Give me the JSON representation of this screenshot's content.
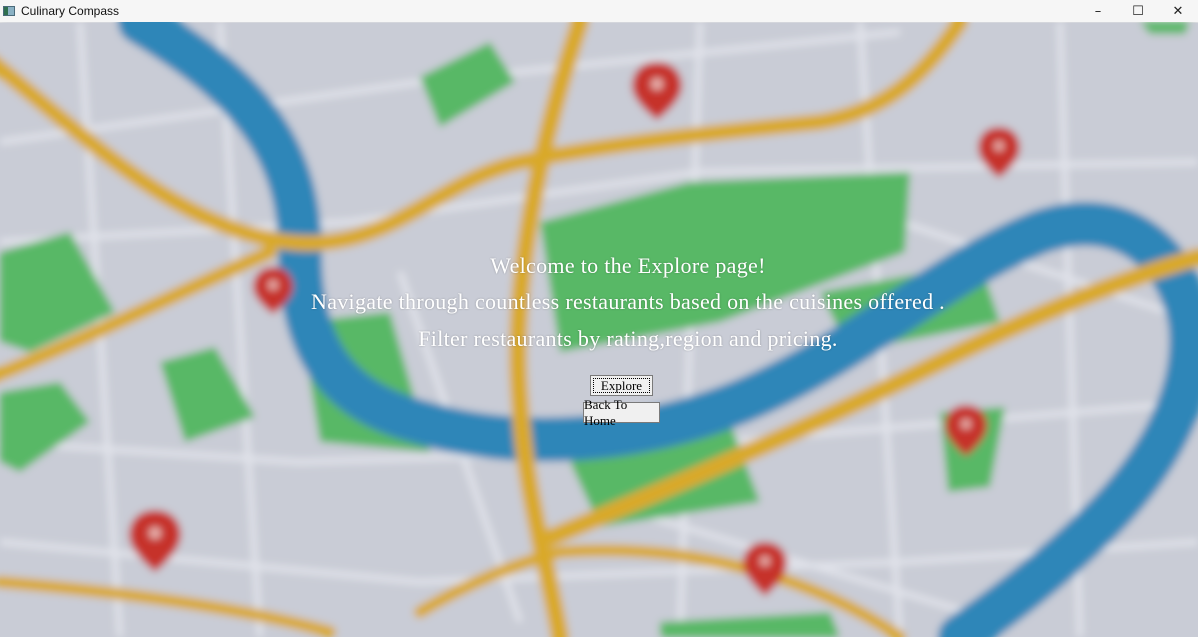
{
  "window": {
    "title": "Culinary Compass",
    "controls": {
      "minimize": "–",
      "maximize": "☐",
      "close": "✕"
    }
  },
  "main": {
    "welcome_line": "Welcome to the Explore page!",
    "navigate_line": "Navigate through countless restaurants based on the cuisines offered .",
    "filter_line": "Filter restaurants by rating,region and pricing.",
    "explore_button": "Explore",
    "back_button": "Back To Home"
  },
  "colors": {
    "map_base": "#c9ccd6",
    "river": "#2f86b8",
    "road": "#d9a92a",
    "park": "#58b866",
    "pin": "#c6302b",
    "text": "#ffffff"
  }
}
